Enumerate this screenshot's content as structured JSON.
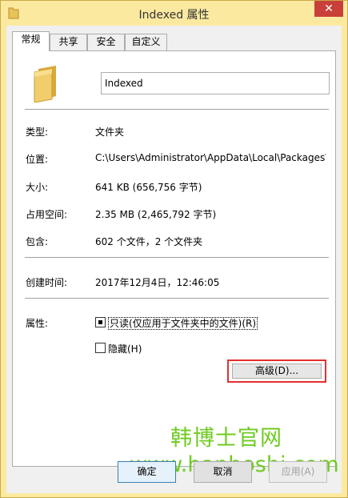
{
  "window": {
    "title": "Indexed 属性",
    "close_glyph": "✕"
  },
  "tabs": [
    {
      "label": "常规",
      "active": true
    },
    {
      "label": "共享",
      "active": false
    },
    {
      "label": "安全",
      "active": false
    },
    {
      "label": "自定义",
      "active": false
    }
  ],
  "general": {
    "name_value": "Indexed",
    "rows": {
      "type_label": "类型:",
      "type_value": "文件夹",
      "location_label": "位置:",
      "location_value": "C:\\Users\\Administrator\\AppData\\Local\\Packages\\",
      "size_label": "大小:",
      "size_value": "641 KB (656,756 字节)",
      "disk_label": "占用空间:",
      "disk_value": "2.35 MB (2,465,792 字节)",
      "contains_label": "包含:",
      "contains_value": "602 个文件，2 个文件夹",
      "created_label": "创建时间:",
      "created_value": "2017年12月4日，12:46:05",
      "attributes_label": "属性:"
    },
    "readonly_label": "只读(仅应用于文件夹中的文件)(R)",
    "readonly_state": "indeterminate",
    "hidden_label": "隐藏(H)",
    "hidden_checked": false,
    "advanced_label": "高级(D)..."
  },
  "watermark": {
    "cn": "韩博士官网",
    "url": "www.hanboshi.com"
  },
  "buttons": {
    "ok": "确定",
    "cancel": "取消",
    "apply": "应用(A)"
  }
}
